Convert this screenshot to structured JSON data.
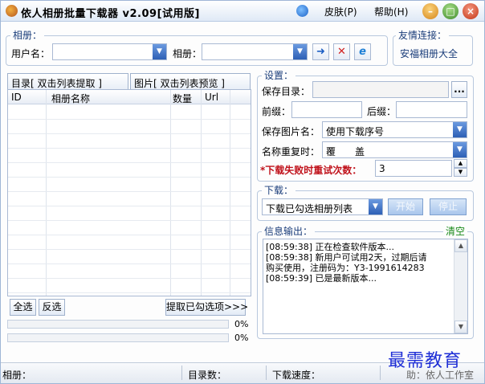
{
  "window": {
    "title": "依人相册批量下载器 v2.09[试用版]",
    "skin_label": "皮肤(P)",
    "help_label": "帮助(H)"
  },
  "album_group": {
    "title": "相册：",
    "username_label": "用户名：",
    "username_value": "",
    "album_label": "相册：",
    "album_value": ""
  },
  "links_group": {
    "title": "友情连接：",
    "link_label": "安福相册大全"
  },
  "tabs": [
    {
      "label": "目录[ 双击列表提取 ]"
    },
    {
      "label": "图片[ 双击列表预览 ]"
    }
  ],
  "table": {
    "columns": [
      "ID",
      "相册名称",
      "数量",
      "Url"
    ],
    "rows": []
  },
  "list_actions": {
    "select_all": "全选",
    "invert": "反选",
    "extract_checked": "提取已勾选项>>>"
  },
  "progress": [
    {
      "value": "0%"
    },
    {
      "value": "0%"
    }
  ],
  "settings": {
    "title": "设置：",
    "save_dir_label": "保存目录：",
    "save_dir_value": "",
    "browse_label": "...",
    "prefix_label": "前缀：",
    "prefix_value": "",
    "suffix_label": "后缀：",
    "suffix_value": "",
    "filename_label": "保存图片名：",
    "filename_value": "使用下载序号",
    "duplicate_label": "名称重复时：",
    "duplicate_value": "覆　　盖",
    "retry_label": "*下载失败时重试次数：",
    "retry_value": "3"
  },
  "download": {
    "title": "下载：",
    "mode_value": "下载已勾选相册列表",
    "start_label": "开始",
    "stop_label": "停止"
  },
  "info": {
    "title": "信息输出：",
    "clear_label": "清空",
    "log": [
      "[08:59:38] 正在检查软件版本...",
      "[08:59:38] 新用户可试用2天，过期后请",
      "购买使用，注册码为：Y3-1991614283",
      "[08:59:39] 已是最新版本..."
    ]
  },
  "statusbar": {
    "album_label": "相册：",
    "dir_count_label": "目录数：",
    "speed_label": "下载速度：",
    "author_text": "助：依人工作室"
  },
  "watermark": {
    "text": "最需教育"
  },
  "colors": {
    "accent": "#2d5fb5",
    "retry_label": "#c0121b",
    "clear_label": "#1a8a1a",
    "watermark": "#1f2fd6"
  }
}
